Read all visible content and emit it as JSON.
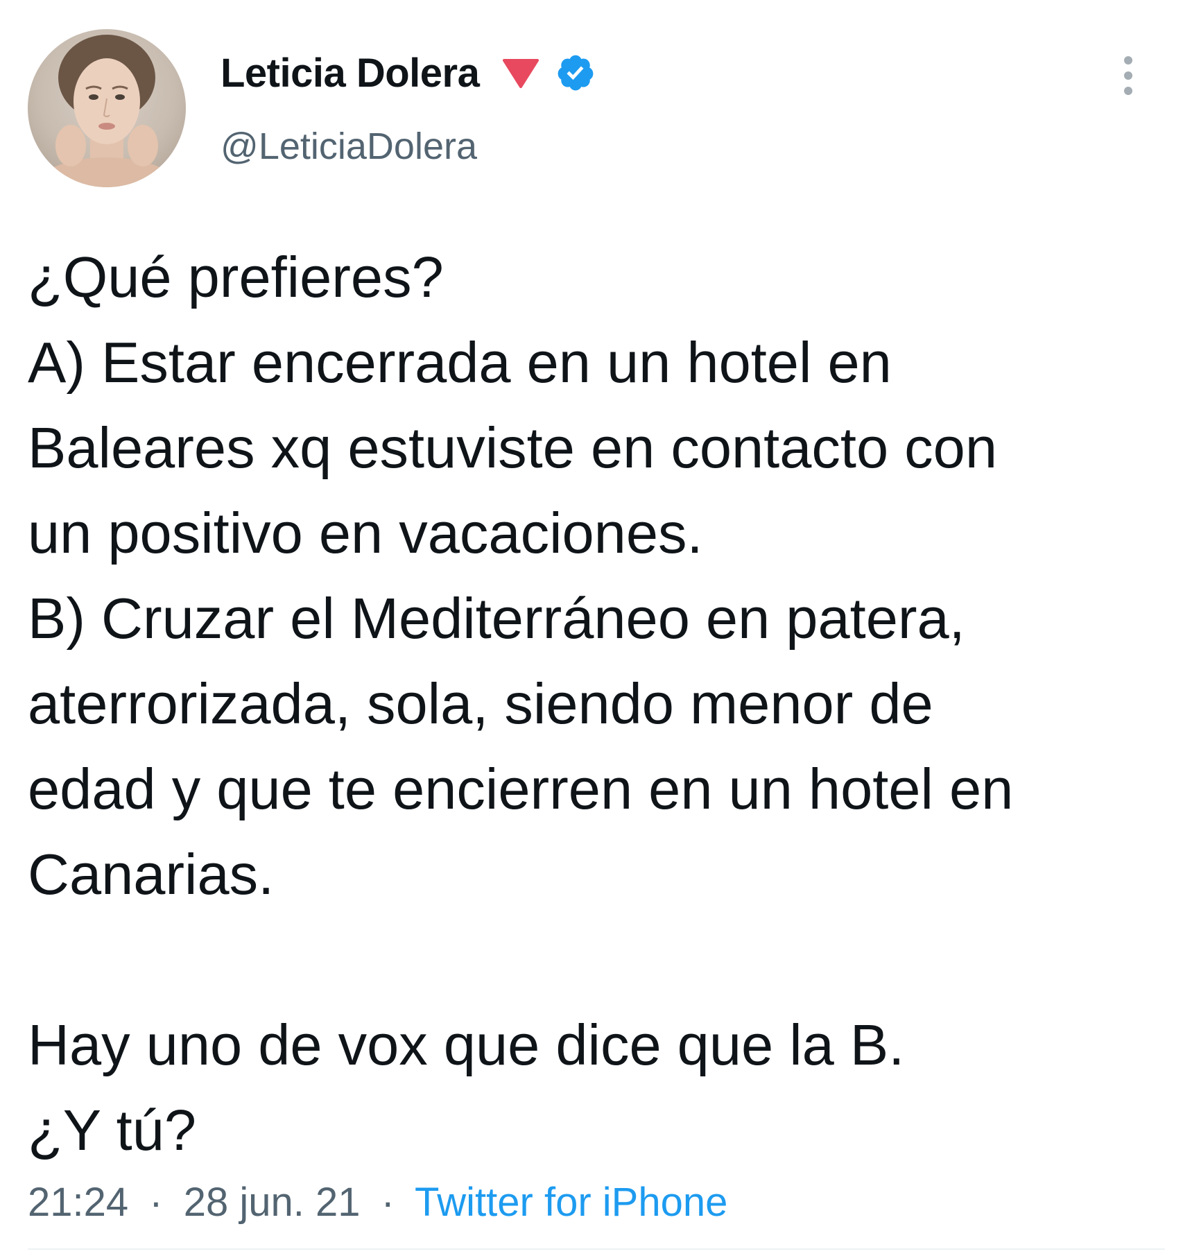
{
  "tweet": {
    "author": {
      "display_name": "Leticia Dolera",
      "handle": "@LeticiaDolera",
      "verified": true,
      "badge_icon": "red-down-triangle-emoji",
      "badge_color": "#e8495f",
      "verified_color": "#1d9bf0"
    },
    "text_lines": [
      "¿Qué prefieres?",
      "A) Estar encerrada en un hotel en",
      "Baleares xq estuviste en contacto con",
      "un positivo en vacaciones.",
      "B) Cruzar el Mediterráneo en patera,",
      "aterrorizada, sola, siendo menor de",
      "edad y que te encierren en un hotel en",
      "Canarias.",
      "",
      "Hay uno de vox que dice que la B.",
      "¿Y tú?"
    ],
    "meta": {
      "time": "21:24",
      "separator": "·",
      "date": "28 jun. 21",
      "source": "Twitter for iPhone"
    }
  }
}
